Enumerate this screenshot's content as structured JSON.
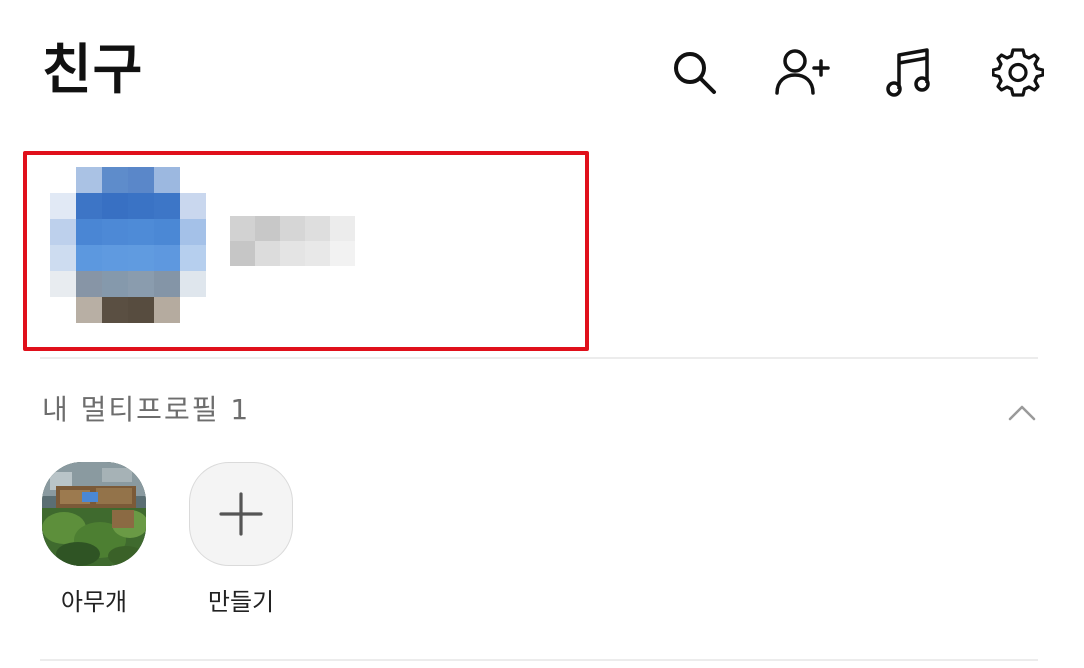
{
  "header": {
    "title": "친구",
    "actions": [
      {
        "icon": "search-icon"
      },
      {
        "icon": "add-friend-icon"
      },
      {
        "icon": "music-icon"
      },
      {
        "icon": "settings-icon"
      }
    ]
  },
  "my_profile": {
    "highlight_color": "#e0101b"
  },
  "multi_profile": {
    "title": "내 멀티프로필 1",
    "collapse_icon": "chevron-up-icon",
    "items": [
      {
        "label": "아무개"
      },
      {
        "label": "만들기"
      }
    ]
  }
}
